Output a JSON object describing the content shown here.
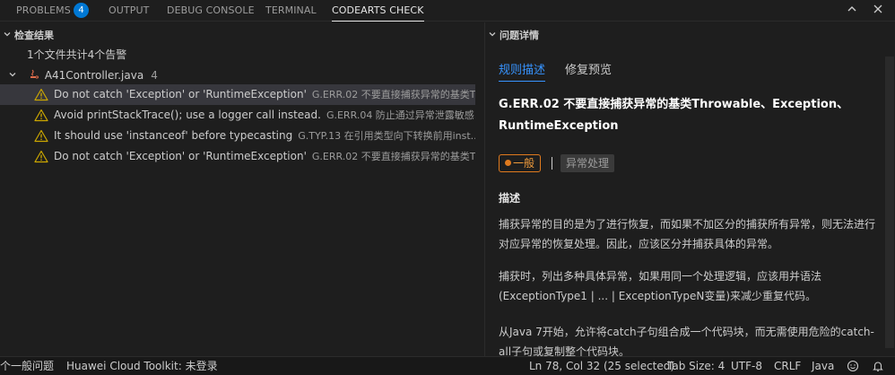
{
  "tabs": [
    {
      "label": "PROBLEMS"
    },
    {
      "label": "OUTPUT"
    },
    {
      "label": "DEBUG CONSOLE"
    },
    {
      "label": "TERMINAL"
    },
    {
      "label": "CODEARTS CHECK"
    }
  ],
  "problems_badge": "4",
  "left_panel": {
    "header": "检查结果",
    "summary": "1个文件共计4个告警",
    "file": {
      "name": "A41Controller.java",
      "count": "4"
    },
    "issues": [
      {
        "message": "Do not catch 'Exception' or 'RuntimeException'",
        "rule": "G.ERR.02 不要直接捕获异常的基类T..."
      },
      {
        "message": "Avoid printStackTrace(); use a logger call instead.",
        "rule": "G.ERR.04 防止通过异常泄露敏感..."
      },
      {
        "message": "It should use 'instanceof' before typecasting",
        "rule": "G.TYP.13 在引用类型向下转换前用inst..."
      },
      {
        "message": "Do not catch 'Exception' or 'RuntimeException'",
        "rule": "G.ERR.02 不要直接捕获异常的基类T..."
      }
    ]
  },
  "right_panel": {
    "header": "问题详情",
    "tabs": [
      {
        "label": "规则描述"
      },
      {
        "label": "修复预览"
      }
    ],
    "title": "G.ERR.02 不要直接捕获异常的基类Throwable、Exception、RuntimeException",
    "level": "一般",
    "category": "异常处理",
    "desc_label": "描述",
    "paragraphs": [
      "捕获异常的目的是为了进行恢复，而如果不加区分的捕获所有异常，则无法进行对应异常的恢复处理。因此，应该区分并捕获具体的异常。",
      "捕获时，列出多种具体异常，如果用同一个处理逻辑，应该用并语法(ExceptionType1 | ... | ExceptionTypeN变量)来减少重复代码。",
      "从Java 7开始，允许将catch子句组合成一个代码块，而无需使用危险的catch-all子句或复制整个代码块。"
    ]
  },
  "statusbar": {
    "problems": "个一般问题",
    "toolkit": "Huawei Cloud Toolkit: 未登录",
    "position": "Ln 78, Col 32 (25 selected)",
    "tab_size": "Tab Size: 4",
    "encoding": "UTF-8",
    "eol": "CRLF",
    "language": "Java"
  },
  "colors": {
    "accent": "#0078d4",
    "link": "#3794ff",
    "warning": "#cca700",
    "level": "#e07a1e"
  }
}
